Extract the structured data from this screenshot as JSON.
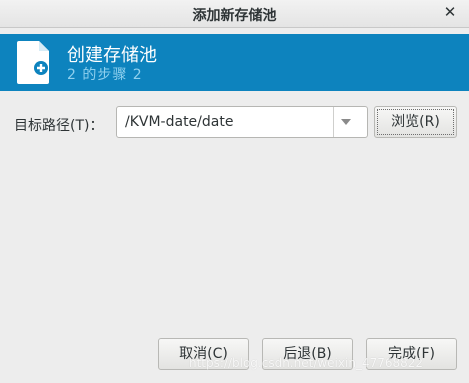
{
  "window": {
    "title": "添加新存储池",
    "close_glyph": "✕"
  },
  "header": {
    "title": "创建存储池",
    "subtitle": "2 的步骤 2",
    "icon": "file-add-icon",
    "background_color": "#0d83be"
  },
  "form": {
    "target_path_label": "目标路径(T)：",
    "target_path_value": "/KVM-date/date",
    "browse_label": "浏览(R)"
  },
  "footer": {
    "cancel_label": "取消(C)",
    "back_label": "后退(B)",
    "finish_label": "完成(F)"
  },
  "watermark": "https://blog.csdn.net/weixin_47768822"
}
